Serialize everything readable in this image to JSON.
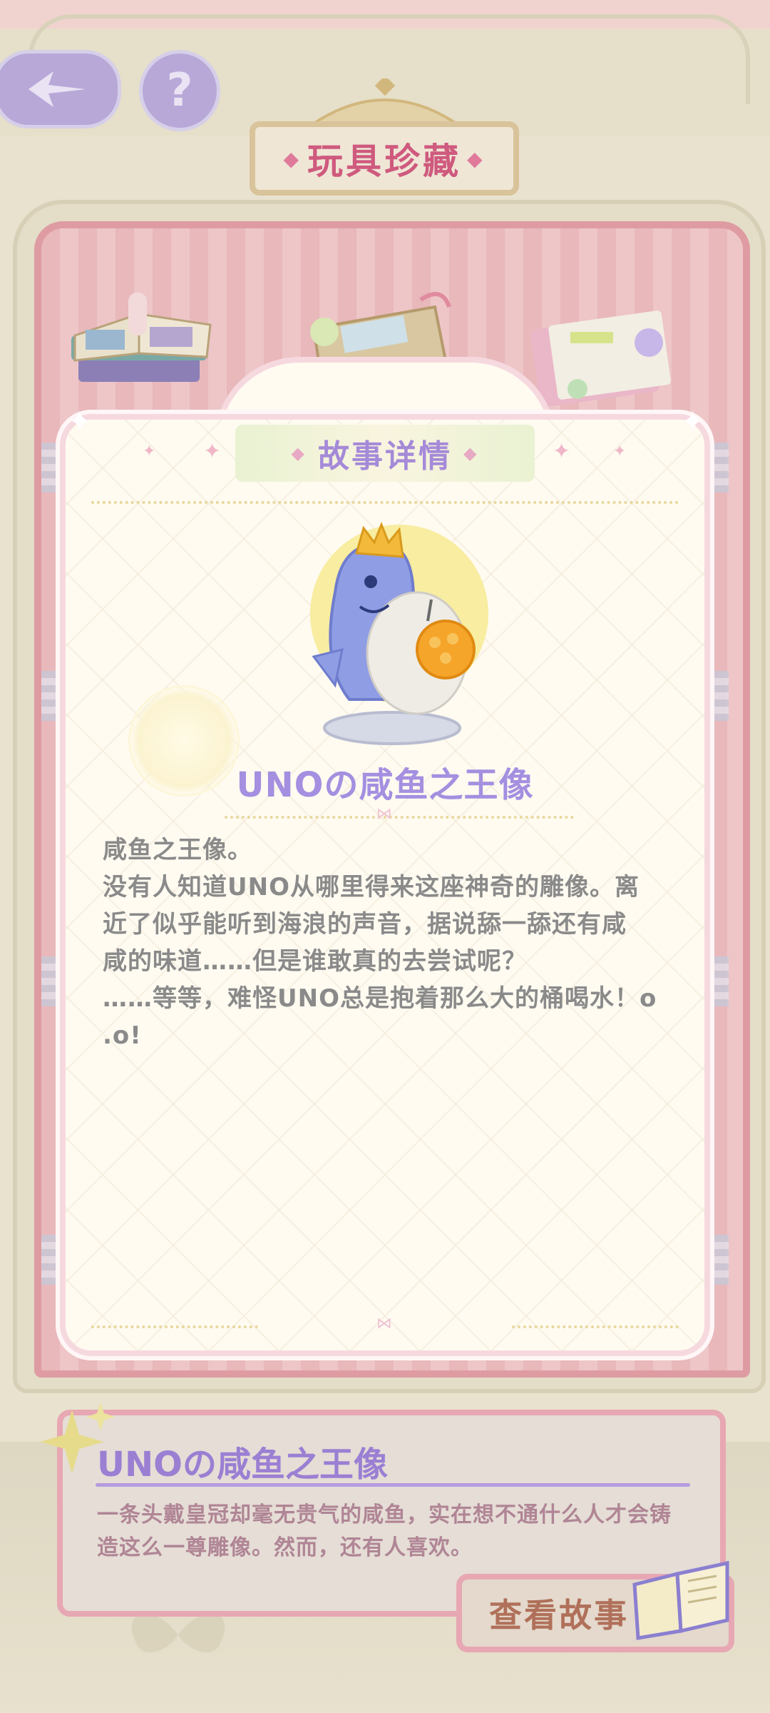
{
  "page": {
    "title": "玩具珍藏"
  },
  "topbar": {
    "back_icon": "back-arrow-icon",
    "help_label": "?"
  },
  "story_card": {
    "header": "故事详情",
    "item_name": "UNOの咸鱼之王像",
    "description": "咸鱼之王像。\n没有人知道UNO从哪里得来这座神奇的雕像。离\n近了似乎能听到海浪的声音，据说舔一舔还有咸\n咸的味道……但是谁敢真的去尝试呢？\n……等等，难怪UNO总是抱着那么大的桶喝水！o\n.o!"
  },
  "info_panel": {
    "title": "UNOの咸鱼之王像",
    "description": "一条头戴皇冠却毫无贵气的咸鱼，实在想不通什么人才会铸造这么一尊雕像。然而，还有人喜欢。",
    "button_label": "查看故事"
  },
  "colors": {
    "accent_purple": "#a48fe0",
    "title_pink": "#cf5a7e",
    "panel_border": "#e7a7b3"
  }
}
